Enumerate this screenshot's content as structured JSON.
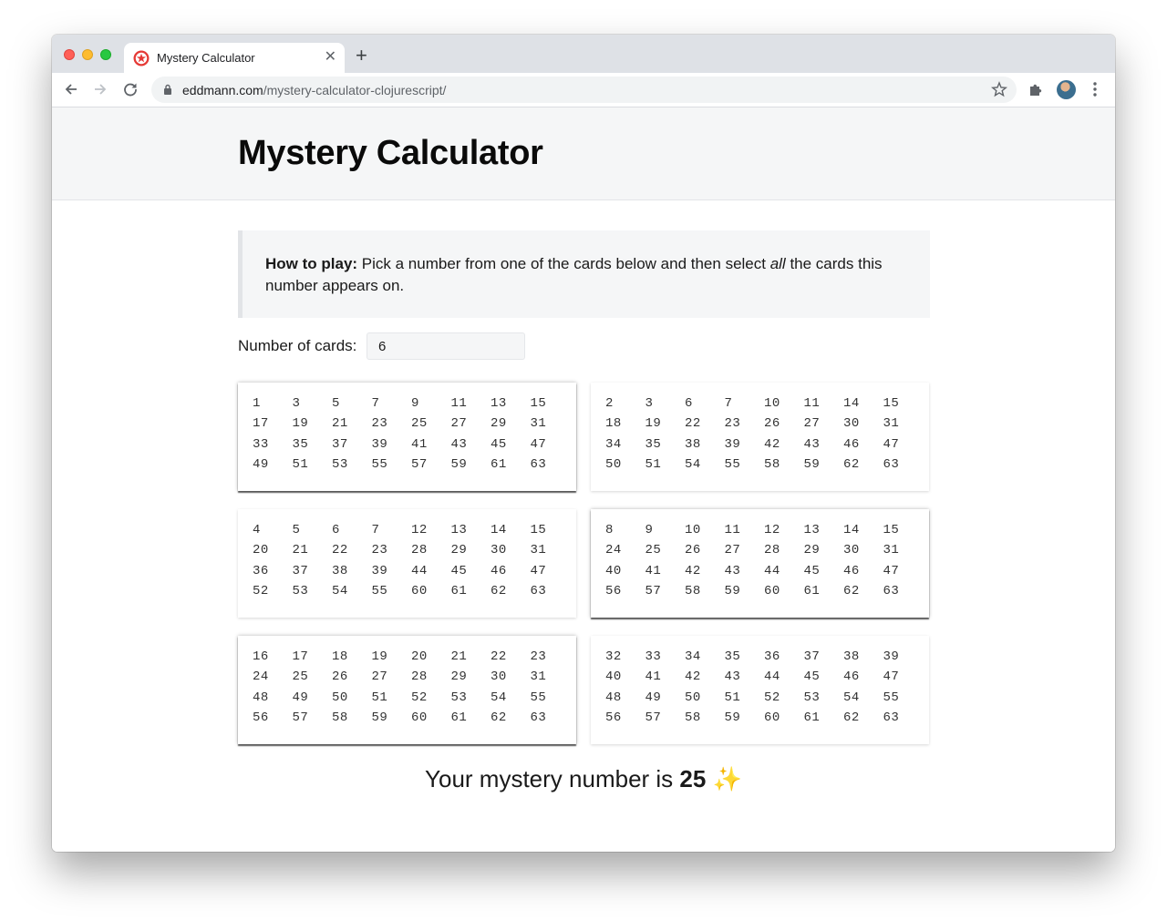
{
  "browser": {
    "tab_title": "Mystery Calculator",
    "url_domain": "eddmann.com",
    "url_path": "/mystery-calculator-clojurescript/"
  },
  "page": {
    "title": "Mystery Calculator",
    "howto_label": "How to play:",
    "howto_text_1": " Pick a number from one of the cards below and then select ",
    "howto_em": "all",
    "howto_text_2": " the cards this number appears on.",
    "count_label": "Number of cards:",
    "count_value": "6",
    "result_prefix": "Your mystery number is ",
    "result_value": "25",
    "result_emoji": "✨"
  },
  "cards": [
    {
      "selected": true,
      "rows": [
        [
          "1",
          "3",
          "5",
          "7",
          "9",
          "11",
          "13",
          "15"
        ],
        [
          "17",
          "19",
          "21",
          "23",
          "25",
          "27",
          "29",
          "31"
        ],
        [
          "33",
          "35",
          "37",
          "39",
          "41",
          "43",
          "45",
          "47"
        ],
        [
          "49",
          "51",
          "53",
          "55",
          "57",
          "59",
          "61",
          "63"
        ]
      ]
    },
    {
      "selected": false,
      "rows": [
        [
          "2",
          "3",
          "6",
          "7",
          "10",
          "11",
          "14",
          "15"
        ],
        [
          "18",
          "19",
          "22",
          "23",
          "26",
          "27",
          "30",
          "31"
        ],
        [
          "34",
          "35",
          "38",
          "39",
          "42",
          "43",
          "46",
          "47"
        ],
        [
          "50",
          "51",
          "54",
          "55",
          "58",
          "59",
          "62",
          "63"
        ]
      ]
    },
    {
      "selected": false,
      "rows": [
        [
          "4",
          "5",
          "6",
          "7",
          "12",
          "13",
          "14",
          "15"
        ],
        [
          "20",
          "21",
          "22",
          "23",
          "28",
          "29",
          "30",
          "31"
        ],
        [
          "36",
          "37",
          "38",
          "39",
          "44",
          "45",
          "46",
          "47"
        ],
        [
          "52",
          "53",
          "54",
          "55",
          "60",
          "61",
          "62",
          "63"
        ]
      ]
    },
    {
      "selected": true,
      "rows": [
        [
          "8",
          "9",
          "10",
          "11",
          "12",
          "13",
          "14",
          "15"
        ],
        [
          "24",
          "25",
          "26",
          "27",
          "28",
          "29",
          "30",
          "31"
        ],
        [
          "40",
          "41",
          "42",
          "43",
          "44",
          "45",
          "46",
          "47"
        ],
        [
          "56",
          "57",
          "58",
          "59",
          "60",
          "61",
          "62",
          "63"
        ]
      ]
    },
    {
      "selected": true,
      "rows": [
        [
          "16",
          "17",
          "18",
          "19",
          "20",
          "21",
          "22",
          "23"
        ],
        [
          "24",
          "25",
          "26",
          "27",
          "28",
          "29",
          "30",
          "31"
        ],
        [
          "48",
          "49",
          "50",
          "51",
          "52",
          "53",
          "54",
          "55"
        ],
        [
          "56",
          "57",
          "58",
          "59",
          "60",
          "61",
          "62",
          "63"
        ]
      ]
    },
    {
      "selected": false,
      "rows": [
        [
          "32",
          "33",
          "34",
          "35",
          "36",
          "37",
          "38",
          "39"
        ],
        [
          "40",
          "41",
          "42",
          "43",
          "44",
          "45",
          "46",
          "47"
        ],
        [
          "48",
          "49",
          "50",
          "51",
          "52",
          "53",
          "54",
          "55"
        ],
        [
          "56",
          "57",
          "58",
          "59",
          "60",
          "61",
          "62",
          "63"
        ]
      ]
    }
  ]
}
